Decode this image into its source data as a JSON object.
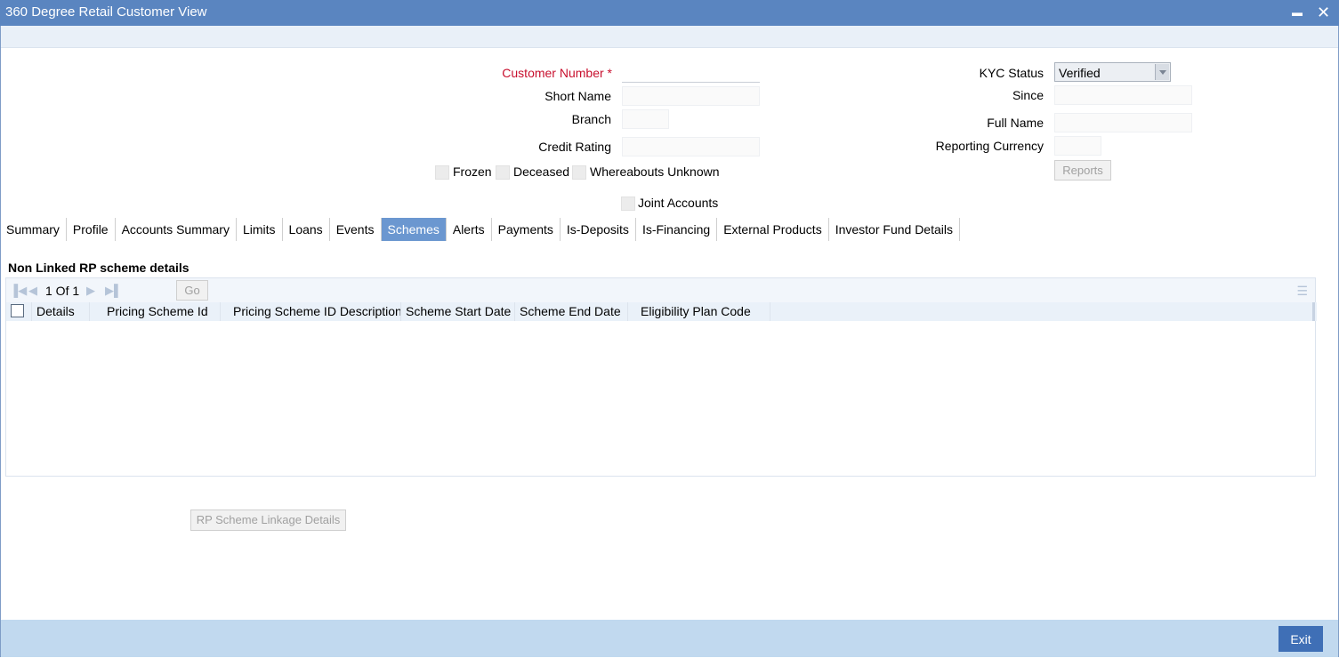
{
  "window": {
    "title": "360 Degree Retail Customer View",
    "minimize_glyph": "▬",
    "close_glyph": "✕"
  },
  "form": {
    "customer_number_label": "Customer Number",
    "required_mark": "*",
    "short_name_label": "Short Name",
    "branch_label": "Branch",
    "credit_rating_label": "Credit Rating",
    "kyc_status_label": "KYC Status",
    "kyc_status_value": "Verified",
    "since_label": "Since",
    "full_name_label": "Full Name",
    "reporting_currency_label": "Reporting Currency",
    "reports_button": "Reports",
    "frozen_label": "Frozen",
    "deceased_label": "Deceased",
    "whereabouts_label": "Whereabouts Unknown",
    "joint_accounts_label": "Joint Accounts"
  },
  "tabs": [
    "Summary",
    "Profile",
    "Accounts Summary",
    "Limits",
    "Loans",
    "Events",
    "Schemes",
    "Alerts",
    "Payments",
    "Is-Deposits",
    "Is-Financing",
    "External Products",
    "Investor Fund Details"
  ],
  "active_tab": "Schemes",
  "section": {
    "title": "Non Linked RP scheme details",
    "pager_text": "1 Of 1",
    "go_label": "Go",
    "columns": [
      "Details",
      "Pricing Scheme Id",
      "Pricing Scheme ID Description",
      "Scheme Start Date",
      "Scheme End Date",
      "Eligibility Plan Code"
    ]
  },
  "rp_linkage_button": "RP Scheme Linkage Details",
  "footer": {
    "exit_label": "Exit"
  },
  "colors": {
    "title_bar": "#5a85c0",
    "active_tab": "#6b97d0",
    "footer": "#c1d9ef",
    "exit_button": "#3f6fb6",
    "required": "#c8102e"
  }
}
